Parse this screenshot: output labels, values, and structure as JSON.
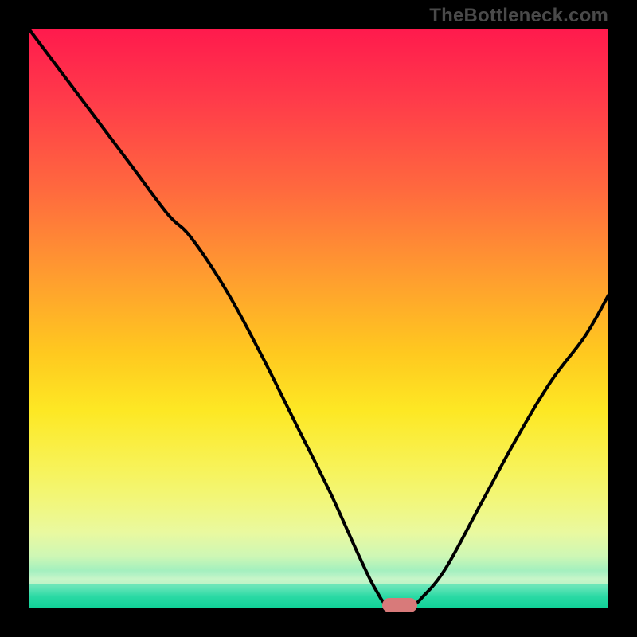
{
  "watermark": "TheBottleneck.com",
  "marker": {
    "x_frac": 0.64,
    "y_frac": 0.994
  },
  "chart_data": {
    "type": "line",
    "title": "",
    "xlabel": "",
    "ylabel": "",
    "xlim": [
      0,
      1
    ],
    "ylim": [
      0,
      1
    ],
    "series": [
      {
        "name": "curve",
        "x": [
          0.0,
          0.06,
          0.12,
          0.18,
          0.24,
          0.28,
          0.34,
          0.4,
          0.46,
          0.52,
          0.57,
          0.6,
          0.62,
          0.66,
          0.68,
          0.72,
          0.78,
          0.84,
          0.9,
          0.96,
          1.0
        ],
        "y": [
          1.0,
          0.92,
          0.84,
          0.76,
          0.68,
          0.64,
          0.55,
          0.44,
          0.32,
          0.2,
          0.09,
          0.03,
          0.006,
          0.006,
          0.02,
          0.07,
          0.18,
          0.29,
          0.39,
          0.47,
          0.54
        ]
      }
    ],
    "background_gradient": {
      "top": "#ff1a4d",
      "mid": "#fde824",
      "bottom": "#0fd197"
    }
  }
}
